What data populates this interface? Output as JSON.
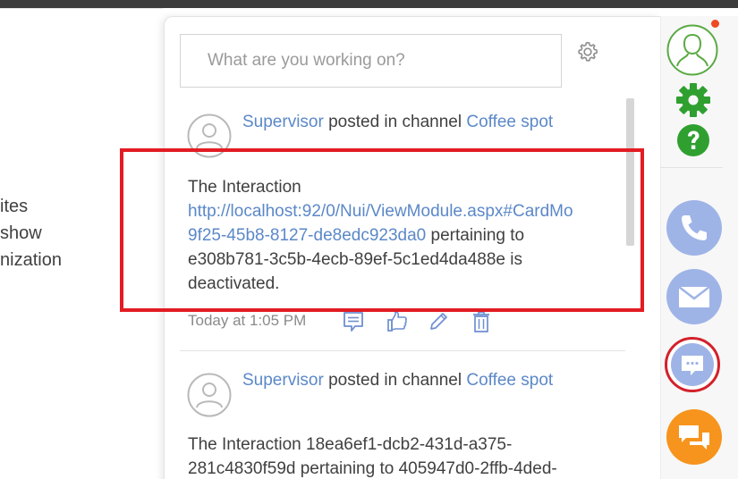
{
  "background": {
    "text_lines": [
      "ites",
      "show",
      "nization"
    ]
  },
  "composer": {
    "placeholder": "What are you working on?",
    "settings_icon": "gear-outline-icon"
  },
  "posts": [
    {
      "author": "Supervisor",
      "verb": "posted in channel",
      "channel": "Coffee spot",
      "body_prefix": "The Interaction",
      "link_line1": "http://localhost:92/0/Nui/ViewModule.aspx#CardMo",
      "link_line2": "9f25-45b8-8127-de8edc923da0",
      "after_link": " pertaining to",
      "line3": "e308b781-3c5b-4ecb-89ef-5c1ed4da488e is",
      "line4": "deactivated.",
      "time": "Today at 1:05 PM"
    },
    {
      "author": "Supervisor",
      "verb": "posted in channel",
      "channel": "Coffee spot",
      "line1": "The Interaction 18ea6ef1-dcb2-431d-a375-",
      "line2": "281c4830f59d pertaining to 405947d0-2ffb-4ded-"
    }
  ],
  "post_actions": [
    "comment-icon",
    "like-icon",
    "edit-icon",
    "delete-icon"
  ],
  "colors": {
    "accent_link": "#5b88c8",
    "highlight": "#e21c22",
    "green": "#2fa02f",
    "action_blue": "#9fb4e6",
    "orange": "#f7941d"
  },
  "right_toolbar": [
    "user-avatar-icon",
    "settings-gear-icon",
    "help-icon",
    "phone-icon",
    "mail-icon",
    "chat-icon",
    "feed-chat-icon"
  ]
}
